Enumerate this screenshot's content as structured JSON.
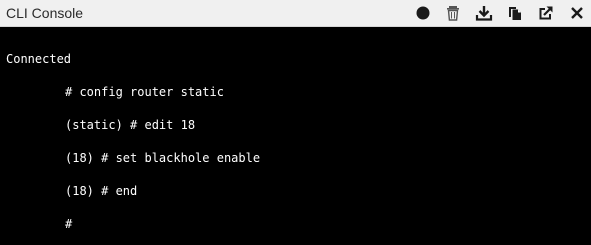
{
  "window": {
    "title": "CLI Console"
  },
  "toolbar": {
    "icons": [
      "record-icon",
      "trash-icon",
      "download-icon",
      "copy-icon",
      "external-link-icon",
      "close-icon"
    ]
  },
  "console": {
    "lines": [
      "Connected",
      "# config router static",
      "(static) # edit 18",
      "(18) # set blackhole enable",
      "(18) # end",
      "#"
    ]
  }
}
